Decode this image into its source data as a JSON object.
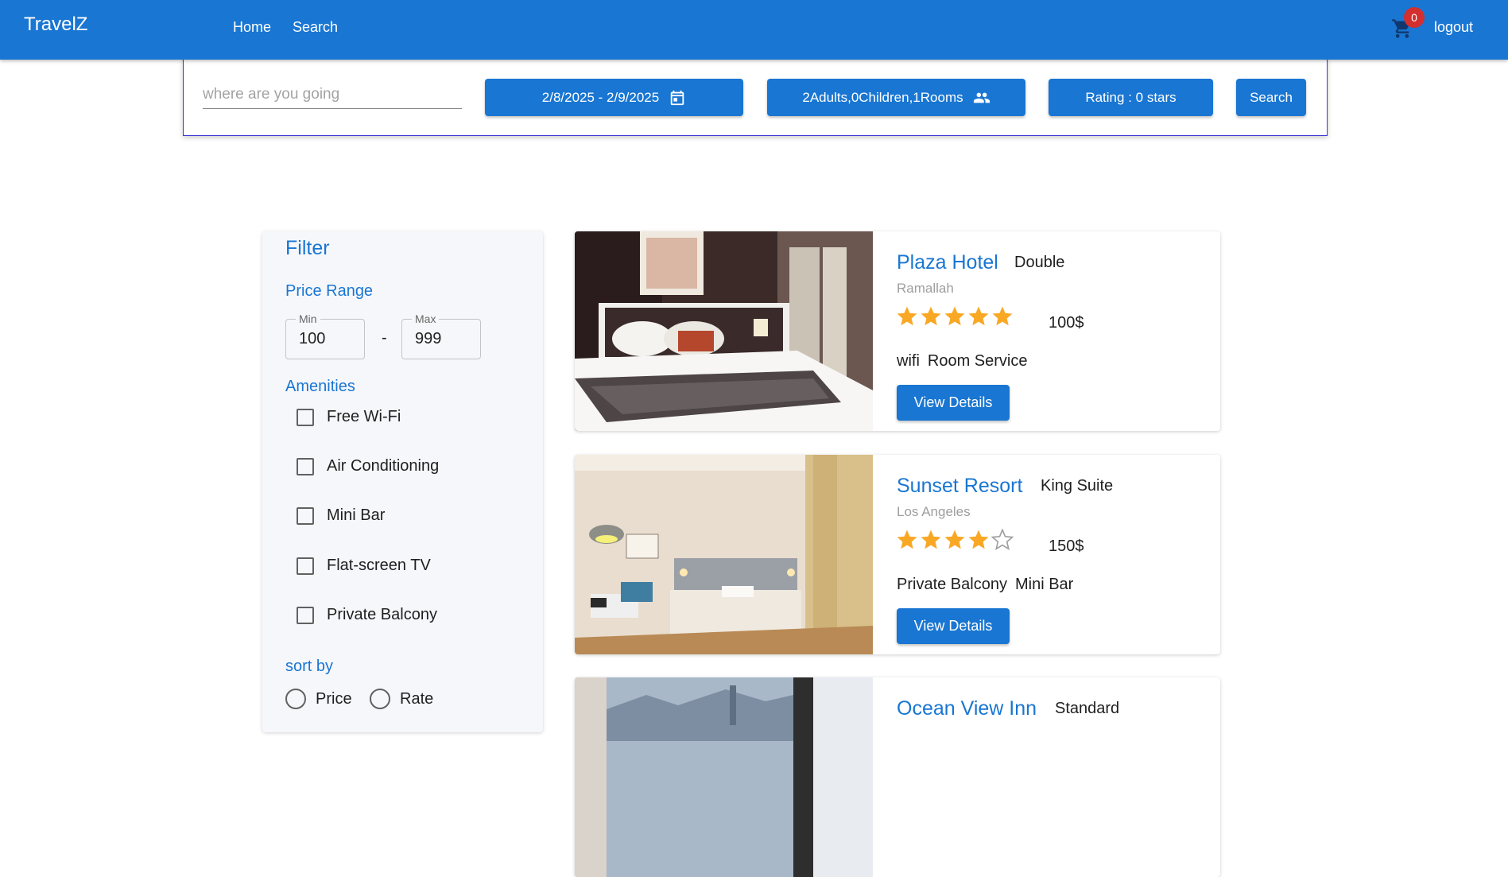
{
  "appbar": {
    "brand": "TravelZ",
    "nav": {
      "home": "Home",
      "search": "Search"
    },
    "cart_count": "0",
    "logout": "logout",
    "colors": {
      "bar": "#1976d2",
      "badge": "#d32f2f"
    },
    "icons": {
      "cart": "shopping-cart-icon"
    }
  },
  "search": {
    "destination_placeholder": "where are you going",
    "destination_value": "",
    "dates_label": "2/8/2025 - 2/9/2025",
    "guests_label": "2Adults,0Children,1Rooms",
    "rating_label": "Rating : 0 stars",
    "search_label": "Search",
    "icons": {
      "dates": "calendar-icon",
      "guests": "people-icon"
    }
  },
  "filter": {
    "title": "Filter",
    "price_range_label": "Price Range",
    "min_label": "Min",
    "min_value": "100",
    "max_label": "Max",
    "max_value": "999",
    "dash": "-",
    "amenities_label": "Amenities",
    "amenities": [
      {
        "label": "Free Wi-Fi",
        "checked": false
      },
      {
        "label": "Air Conditioning",
        "checked": false
      },
      {
        "label": "Mini Bar",
        "checked": false
      },
      {
        "label": "Flat-screen TV",
        "checked": false
      },
      {
        "label": "Private Balcony",
        "checked": false
      }
    ],
    "sort_label": "sort by",
    "sort_options": [
      {
        "label": "Price",
        "selected": false
      },
      {
        "label": "Rate",
        "selected": false
      }
    ]
  },
  "hotels": [
    {
      "name": "Plaza Hotel",
      "room_type": "Double",
      "city": "Ramallah",
      "rating": 5,
      "price": "100$",
      "amenities": [
        "wifi",
        "Room Service"
      ],
      "button": "View Details"
    },
    {
      "name": "Sunset Resort",
      "room_type": "King Suite",
      "city": "Los Angeles",
      "rating": 4,
      "price": "150$",
      "amenities": [
        "Private Balcony",
        "Mini Bar"
      ],
      "button": "View Details"
    },
    {
      "name": "Ocean View Inn",
      "room_type": "Standard",
      "city": "",
      "rating": 0,
      "price": "",
      "amenities": [],
      "button": ""
    }
  ],
  "colors": {
    "primary": "#1976d2",
    "star_filled": "#f9a825",
    "star_empty": "#9e9e9e"
  }
}
